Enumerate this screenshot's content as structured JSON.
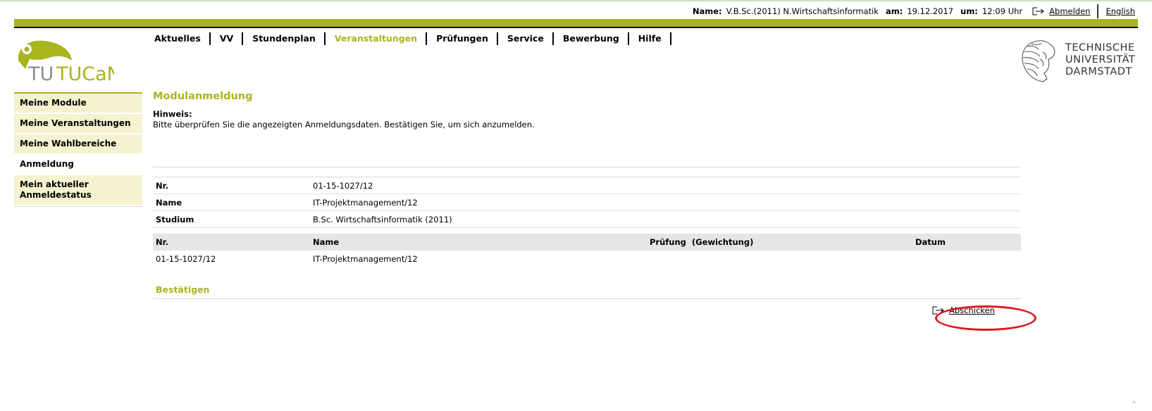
{
  "userbar": {
    "name_label": "Name:",
    "name_value": "V.B.Sc.(2011) N.Wirtschaftsinformatik",
    "date_label": "am:",
    "date_value": "19.12.2017",
    "time_label": "um:",
    "time_value": "12:09 Uhr",
    "logout_label": "Abmelden",
    "language_label": "English"
  },
  "logo": {
    "text": "TUCaN"
  },
  "university": {
    "line1": "TECHNISCHE",
    "line2": "UNIVERSITÄT",
    "line3": "DARMSTADT"
  },
  "nav": {
    "items": [
      {
        "label": "Aktuelles"
      },
      {
        "label": "VV"
      },
      {
        "label": "Stundenplan"
      },
      {
        "label": "Veranstaltungen"
      },
      {
        "label": "Prüfungen"
      },
      {
        "label": "Service"
      },
      {
        "label": "Bewerbung"
      },
      {
        "label": "Hilfe"
      }
    ],
    "active_label": "Veranstaltungen"
  },
  "sidebar": {
    "items": [
      {
        "label": "Meine Module"
      },
      {
        "label": "Meine Veranstaltungen"
      },
      {
        "label": "Meine Wahlbereiche"
      },
      {
        "label": "Anmeldung"
      },
      {
        "label": "Mein aktueller Anmeldestatus"
      }
    ]
  },
  "main": {
    "title": "Modulanmeldung",
    "hint_label": "Hinweis:",
    "hint_text": "Bitte überprüfen Sie die angezeigten Anmeldungsdaten. Bestätigen Sie, um sich anzumelden.",
    "info": {
      "nr_label": "Nr.",
      "nr_value": "01-15-1027/12",
      "name_label": "Name",
      "name_value": "IT-Projektmanagement/12",
      "studium_label": "Studium",
      "studium_value": "B.Sc. Wirtschaftsinformatik (2011)"
    },
    "table": {
      "headers": [
        "Nr.",
        "Name",
        "Prüfung  (Gewichtung)",
        "Datum"
      ],
      "rows": [
        [
          "01-15-1027/12",
          "IT-Projektmanagement/12",
          "",
          ""
        ]
      ]
    },
    "confirm_heading": "Bestätigen",
    "submit_label": "Abschicken"
  },
  "colors": {
    "brand_green": "#a8b51e",
    "sidebar_bg": "#f5f3cf",
    "table_header_bg": "#e6e6e6",
    "highlight_red": "#e0161a"
  }
}
